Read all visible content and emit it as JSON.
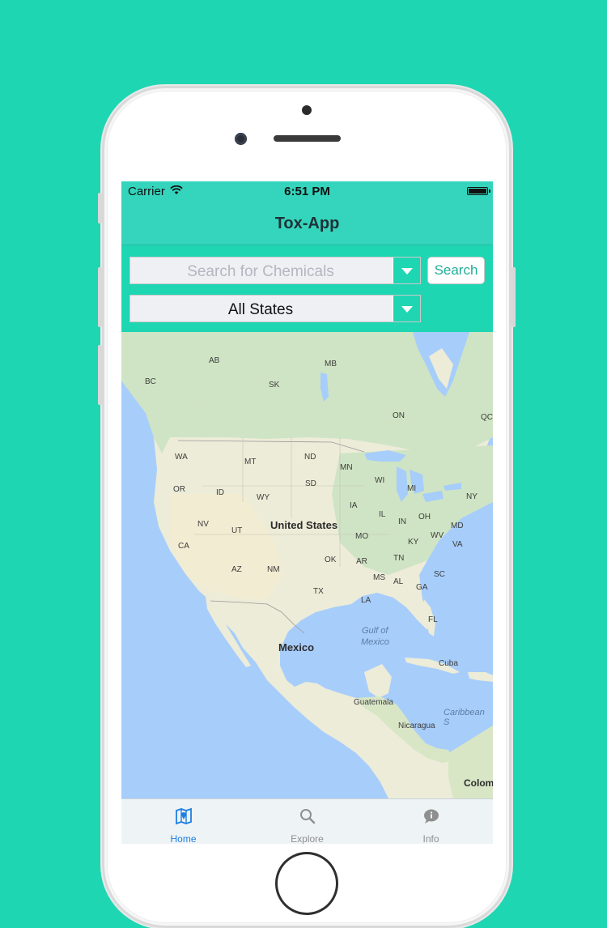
{
  "status_bar": {
    "carrier": "Carrier",
    "time": "6:51 PM"
  },
  "nav": {
    "title": "Tox-App"
  },
  "search": {
    "placeholder": "Search for Chemicals",
    "button_label": "Search"
  },
  "state_filter": {
    "selected": "All States"
  },
  "map": {
    "labels": {
      "ab": "AB",
      "bc": "BC",
      "sk": "SK",
      "mb": "MB",
      "on": "ON",
      "qc": "QC",
      "wa": "WA",
      "mt": "MT",
      "nd": "ND",
      "mn": "MN",
      "or": "OR",
      "id": "ID",
      "wy": "WY",
      "sd": "SD",
      "wi": "WI",
      "mi": "MI",
      "ny": "NY",
      "nv": "NV",
      "ut": "UT",
      "ia": "IA",
      "il": "IL",
      "in": "IN",
      "oh": "OH",
      "md": "MD",
      "ca": "CA",
      "mo": "MO",
      "ky": "KY",
      "wv": "WV",
      "va": "VA",
      "ok": "OK",
      "ar": "AR",
      "tn": "TN",
      "az": "AZ",
      "nm": "NM",
      "sc": "SC",
      "ms": "MS",
      "al": "AL",
      "ga": "GA",
      "tx": "TX",
      "la": "LA",
      "fl": "FL",
      "united_states": "United States",
      "gulf_line1": "Gulf of",
      "gulf_line2": "Mexico",
      "mexico": "Mexico",
      "cuba": "Cuba",
      "guatemala": "Guatemala",
      "caribbean": "Caribbean S",
      "nicaragua": "Nicaragua",
      "colombia": "Colom"
    }
  },
  "tabs": [
    {
      "label": "Home",
      "icon": "map-icon",
      "active": true
    },
    {
      "label": "Explore",
      "icon": "magnifier-icon",
      "active": false
    },
    {
      "label": "Info",
      "icon": "speech-bubble-icon",
      "active": false
    }
  ],
  "colors": {
    "background": "#1fd6b3",
    "nav": "#34d5bc",
    "active_tab": "#1e7fe0",
    "inactive_tab": "#8f8f8f"
  }
}
